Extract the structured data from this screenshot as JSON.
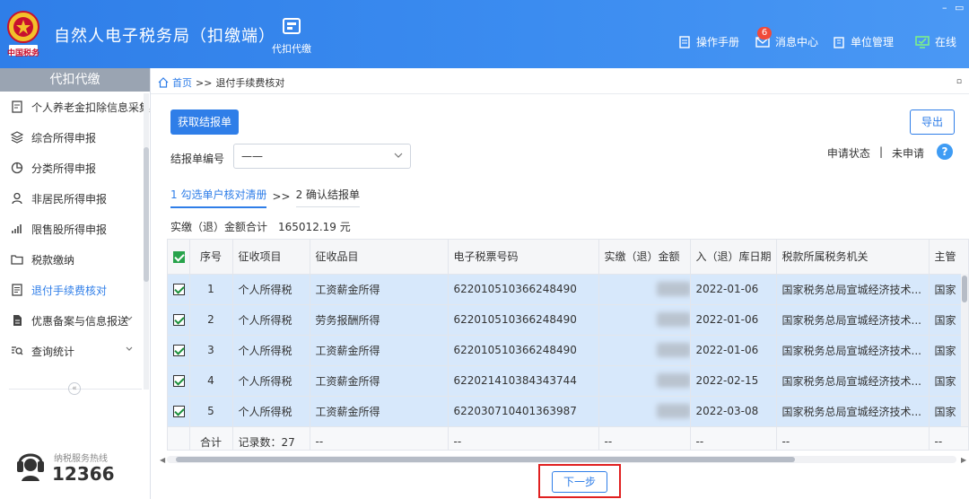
{
  "header": {
    "app_title": "自然人电子税务局（扣缴端）",
    "emblem_text": "中国税务",
    "module_label": "代扣代缴",
    "items": [
      {
        "label": "操作手册",
        "icon": "manual-icon"
      },
      {
        "label": "消息中心",
        "icon": "mail-icon",
        "badge": "6"
      },
      {
        "label": "单位管理",
        "icon": "building-icon"
      },
      {
        "label": "在线",
        "icon": "monitor-icon"
      }
    ],
    "window_controls": [
      "–",
      "▭"
    ]
  },
  "sidebar": {
    "title": "代扣代缴",
    "items": [
      {
        "label": "个人养老金扣除信息采集",
        "icon": "form-icon"
      },
      {
        "label": "综合所得申报",
        "icon": "layers-icon"
      },
      {
        "label": "分类所得申报",
        "icon": "pie-icon"
      },
      {
        "label": "非居民所得申报",
        "icon": "person-icon"
      },
      {
        "label": "限售股所得申报",
        "icon": "bar-icon"
      },
      {
        "label": "税款缴纳",
        "icon": "folder-icon"
      },
      {
        "label": "退付手续费核对",
        "icon": "list-icon",
        "active": true
      },
      {
        "label": "优惠备案与信息报送",
        "icon": "doc-icon",
        "expandable": true
      },
      {
        "label": "查询统计",
        "icon": "search-icon",
        "expandable": true
      }
    ],
    "collapse_glyph": "«",
    "hotline_label": "纳税服务热线",
    "hotline_number": "12366"
  },
  "breadcrumb": {
    "home": "首页",
    "sep": ">>",
    "current": "退付手续费核对"
  },
  "toolbar": {
    "fetch_label": "获取结报单",
    "export_label": "导出"
  },
  "form": {
    "report_no_label": "结报单编号",
    "report_no_value": "——"
  },
  "status": {
    "label": "申请状态",
    "sep": "|",
    "value": "未申请",
    "help": "?"
  },
  "steps": {
    "step1": "1 勾选单户核对清册",
    "arrow": ">>",
    "step2": "2 确认结报单"
  },
  "total": {
    "label": "实缴（退）金额合计",
    "value": "165012.19 元"
  },
  "table": {
    "columns": [
      "序号",
      "征收项目",
      "征收品目",
      "电子税票号码",
      "实缴（退）金额",
      "入（退）库日期",
      "税款所属税务机关",
      "主管"
    ],
    "rows": [
      {
        "no": "1",
        "item": "个人所得税",
        "category": "工资薪金所得",
        "ticket": "622010510366248490",
        "date": "2022-01-06",
        "office": "国家税务总局宣城经济技术...",
        "mgr": "国家"
      },
      {
        "no": "2",
        "item": "个人所得税",
        "category": "劳务报酬所得",
        "ticket": "622010510366248490",
        "date": "2022-01-06",
        "office": "国家税务总局宣城经济技术...",
        "mgr": "国家"
      },
      {
        "no": "3",
        "item": "个人所得税",
        "category": "工资薪金所得",
        "ticket": "622010510366248490",
        "date": "2022-01-06",
        "office": "国家税务总局宣城经济技术...",
        "mgr": "国家"
      },
      {
        "no": "4",
        "item": "个人所得税",
        "category": "工资薪金所得",
        "ticket": "622021410384343744",
        "date": "2022-02-15",
        "office": "国家税务总局宣城经济技术...",
        "mgr": "国家"
      },
      {
        "no": "5",
        "item": "个人所得税",
        "category": "工资薪金所得",
        "ticket": "622030710401363987",
        "date": "2022-03-08",
        "office": "国家税务总局宣城经济技术...",
        "mgr": "国家"
      }
    ],
    "summary": {
      "label": "合计",
      "count": "记录数：27",
      "dash": "--"
    }
  },
  "next_label": "下一步",
  "colors": {
    "primary": "#2f7ee8",
    "selected_row": "#d7e8fb",
    "highlight": "#e02020"
  }
}
